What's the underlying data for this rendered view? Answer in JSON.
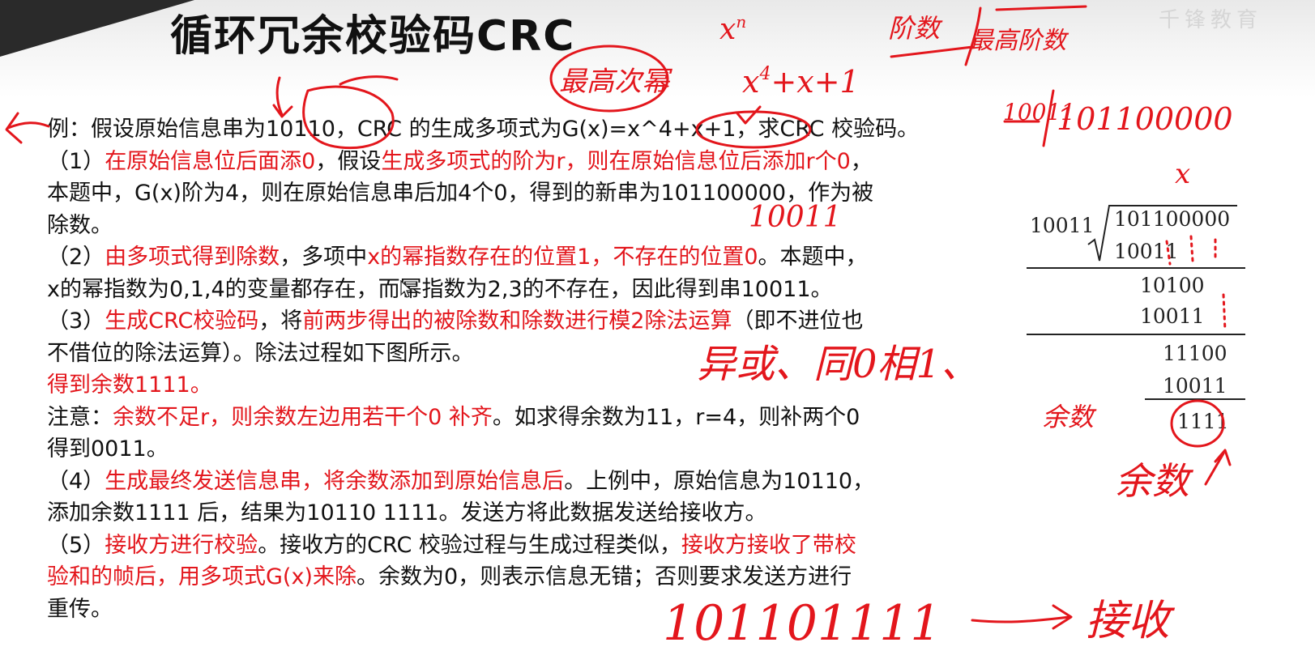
{
  "slide": {
    "title": "循环冗余校验码CRC",
    "watermark": "千锋教育",
    "colors": {
      "text": "#111111",
      "emphasis": "#e3161c",
      "ink": "#e3161c"
    }
  },
  "body": {
    "example": {
      "s1": "例：假设原始信息串为10110，CRC 的生成多项式为G(x)=x^4+x+1，求CRC 校验码。"
    },
    "step1": {
      "p1": "（1）",
      "r1": "在原始信息位后面添0",
      "p2": "，假设",
      "r2": "生成多项式的阶为r，则在原始信息位后添加r个0",
      "p3": "，",
      "l2": "本题中，G(x)阶为4，则在原始信息串后加4个0，得到的新串为101100000，作为被",
      "l3": "除数。"
    },
    "step2": {
      "p1": "（2）",
      "r1": "由多项式得到除数",
      "p2": "，多项中",
      "r2": "x的幂指数存在的位置1，不存在的位置0",
      "p3": "。本题中，",
      "l2": "x的幂指数为0,1,4的变量都存在，而幂指数为2,3的不存在，因此得到串10011。"
    },
    "step3": {
      "p1": "（3）",
      "r1": "生成CRC校验码",
      "p2": "，将",
      "r2": "前两步得出的被除数和除数进行模2除法运算",
      "p3": "（即不进位也",
      "l2": "不借位的除法运算）。除法过程如下图所示。",
      "l3": "得到余数1111。"
    },
    "note": {
      "p1": "注意：",
      "r1": "余数不足r，则余数左边用若干个0 补齐",
      "p2": "。如求得余数为11，r=4，则补两个0",
      "l2": "得到0011。"
    },
    "step4": {
      "p1": "（4）",
      "r1": "生成最终发送信息串，将余数添加到原始信息后",
      "p2": "。上例中，原始信息为10110，",
      "l2": "添加余数1111 后，结果为10110 1111。发送方将此数据发送给接收方。"
    },
    "step5": {
      "p1": "（5）",
      "r1": "接收方进行校验",
      "p2": "。接收方的CRC 校验过程与生成过程类似，",
      "r2": "接收方接收了带校",
      "r3": "验和的帧后，用多项式G(x)来除",
      "p3": "。余数为0，则表示信息无错；否则要求发送方进行",
      "l3": "重传。"
    }
  },
  "division": {
    "divisor": "10011",
    "dividend": "101100000",
    "steps": [
      "10011",
      "10100",
      "10011",
      "11100",
      "10011"
    ],
    "remainder": "1111"
  },
  "annotations": {
    "power": "x",
    "power_sup": "n",
    "highest_power": "最高次幂",
    "poly": "x",
    "poly_sup": "4",
    "poly_tail": "+x+1",
    "order": "阶数",
    "highest_order": "最高阶数",
    "top_right_divisor": "10011",
    "top_right_dividend": "101100000",
    "times": "x",
    "divisor_below": "10011",
    "xor": "异或、同0相1、",
    "remainder_label": "余数",
    "remainder_word": "余数",
    "sent_frame": "101101111",
    "receive": "接收"
  }
}
